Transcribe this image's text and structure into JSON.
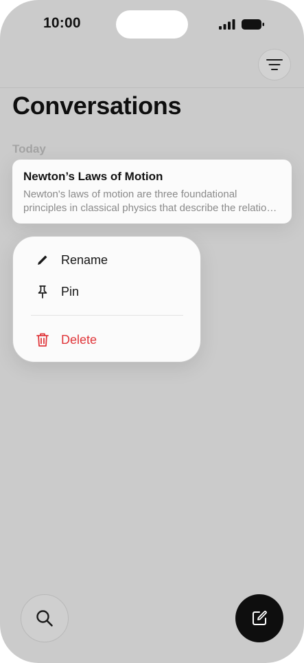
{
  "status_bar": {
    "time": "10:00",
    "signal_icon": "cellular-signal-icon",
    "battery_icon": "battery-icon"
  },
  "header": {
    "filter_icon": "filter-lines-icon",
    "title": "Conversations"
  },
  "sections": [
    {
      "label": "Today",
      "items": [
        {
          "title": "Newton’s Laws of Motion",
          "preview_line1": "Newton's laws of motion are three foundational",
          "preview_line2": "principles in classical physics that describe the relationship between the motion of an object and the forces acting on it."
        }
      ]
    }
  ],
  "context_menu": {
    "items": [
      {
        "label": "Rename",
        "icon": "pencil-icon",
        "destructive": false
      },
      {
        "label": "Pin",
        "icon": "pin-icon",
        "destructive": false
      },
      {
        "label": "Delete",
        "icon": "trash-icon",
        "destructive": true
      }
    ]
  },
  "bottom_bar": {
    "search_icon": "search-icon",
    "compose_icon": "compose-icon"
  },
  "colors": {
    "background_dimmed": "#cbcbcb",
    "card_background": "#fbfbfb",
    "destructive": "#e0363a",
    "compose_button": "#0e0e0e"
  }
}
